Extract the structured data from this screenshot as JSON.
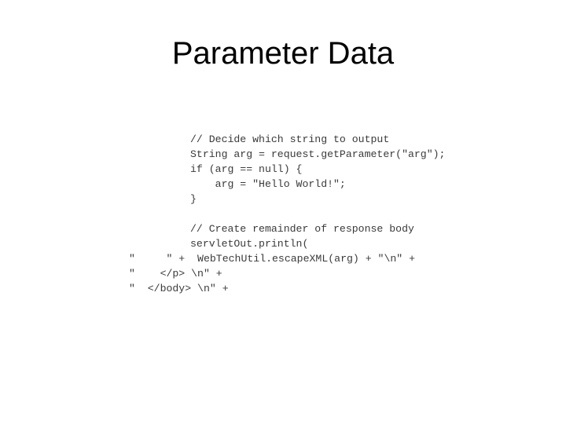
{
  "slide": {
    "title": "Parameter Data"
  },
  "code": {
    "lines": [
      "// Decide which string to output",
      "String arg = request.getParameter(\"arg\");",
      "if (arg == null) {",
      "    arg = \"Hello World!\";",
      "}",
      "",
      "// Create remainder of response body",
      "servletOut.println(",
      "\"     \" +  WebTechUtil.escapeXML(arg) + \"\\n\" +",
      "\"    </p> \\n\" +",
      "\"  </body> \\n\" +"
    ]
  }
}
